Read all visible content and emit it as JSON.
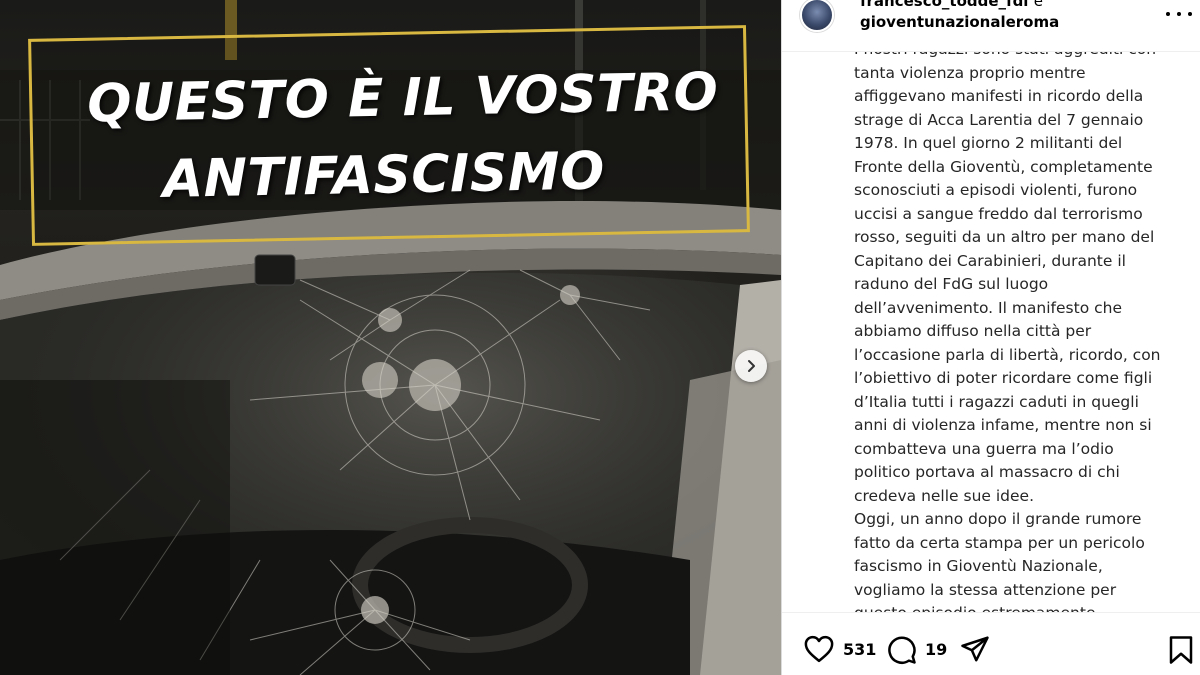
{
  "media": {
    "headline_line1": "QUESTO È IL VOSTRO",
    "headline_line2": "ANTIFASCISMO",
    "accent_color": "#d9b842"
  },
  "header": {
    "user1": "francesco_todde_fdi",
    "and_text": "e",
    "user2": "gioventunazionaleroma"
  },
  "caption": {
    "text": "I nostri ragazzi sono stati aggrediti con\ntanta violenza proprio mentre\naffiggevano manifesti in ricordo della\nstrage di Acca Larentia del 7 gennaio\n1978. In quel giorno 2 militanti del\nFronte della Gioventù, completamente\nsconosciuti a episodi violenti, furono\nuccisi a sangue freddo dal terrorismo\nrosso, seguiti da un altro per mano del\nCapitano dei Carabinieri, durante il\nraduno del FdG sul luogo\ndell’avvenimento. Il manifesto che\nabbiamo diffuso nella città per\nl’occasione parla di libertà, ricordo, con\nl’obiettivo di poter ricordare come figli\nd’Italia tutti i ragazzi caduti in quegli\nanni di violenza infame, mentre non si\ncombatteva una guerra ma l’odio\npolitico portava al massacro di chi\ncredeva nelle sue idee.\nOggi, un anno dopo il grande rumore\nfatto da certa stampa per un pericolo\nfascismo in Gioventù Nazionale,\nvogliamo la stessa attenzione per\nquesto episodio estremamente"
  },
  "actions": {
    "likes": "531",
    "comments": "19",
    "icons": [
      "heart-icon",
      "comment-icon",
      "share-icon",
      "bookmark-icon"
    ]
  }
}
